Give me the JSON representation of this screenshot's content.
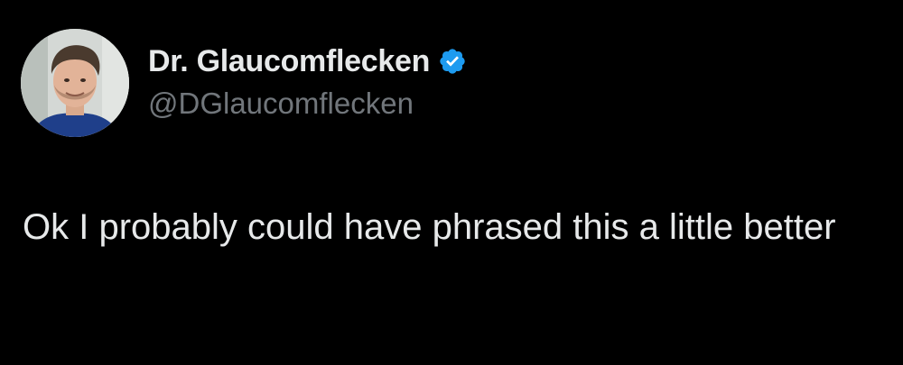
{
  "tweet": {
    "author": {
      "display_name": "Dr. Glaucomflecken",
      "handle": "@DGlaucomflecken",
      "verified": true,
      "verified_icon": "verified-badge-icon",
      "verified_color": "#1d9bf0"
    },
    "text": "Ok I probably could have phrased this a little better"
  },
  "colors": {
    "background": "#000000",
    "primary_text": "#e7e9ea",
    "secondary_text": "#71767b"
  }
}
